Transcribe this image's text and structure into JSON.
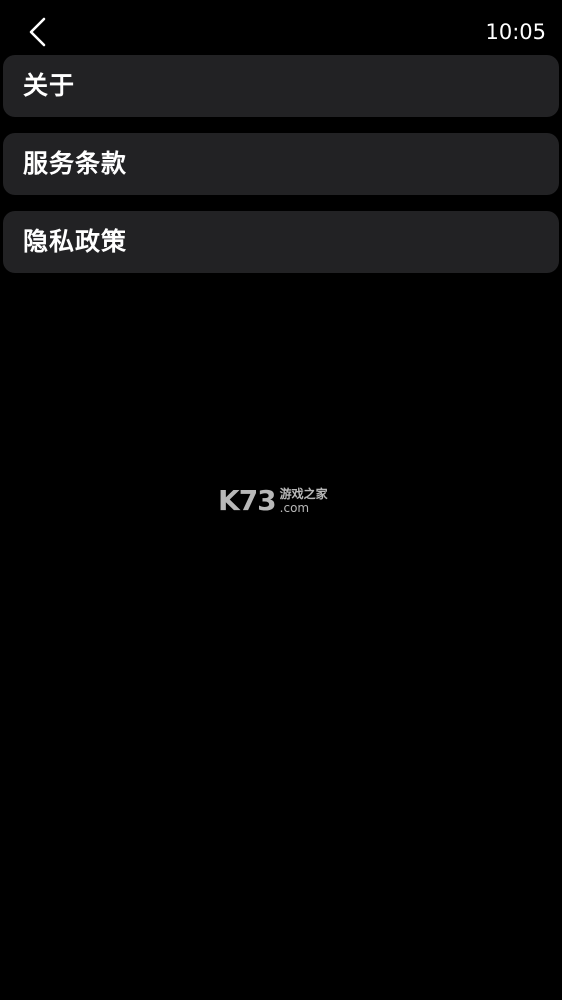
{
  "header": {
    "time": "10:05",
    "back_icon": "chevron-left-icon"
  },
  "menu": {
    "items": [
      {
        "label": "关于"
      },
      {
        "label": "服务条款"
      },
      {
        "label": "隐私政策"
      }
    ]
  },
  "watermark": {
    "main": "K73",
    "cn": "游戏之家",
    "domain": ".com"
  },
  "colors": {
    "background": "#000000",
    "card": "#222224",
    "text": "#ffffff"
  }
}
